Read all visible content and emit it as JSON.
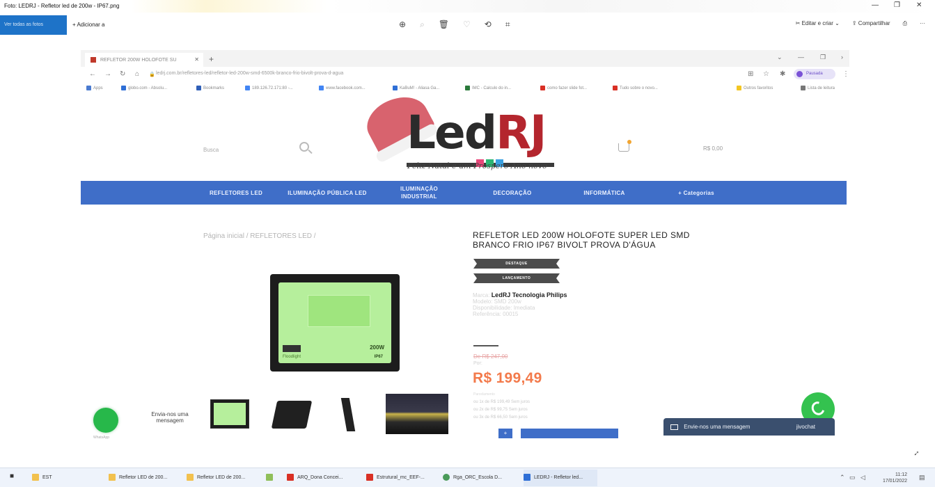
{
  "photos_app": {
    "title": "Foto:  LEDRJ - Refletor led de 200w - IP67.png",
    "see_all_label": "Ver todas as fotos",
    "add_to_label": "Adicionar a",
    "edit_create_label": "Editar e criar",
    "share_label": "Compartilhar",
    "window_controls": [
      "—",
      "❐",
      "✕"
    ]
  },
  "browser": {
    "tab_title": "REFLETOR 200W HOLOFOTE SU",
    "url": "ledrj.com.br/refletores-led/refletor-led-200w-smd-6500k-branco-frio-bivolt-prova-d-agua",
    "profile_label": "Pausada",
    "bookmarks": [
      {
        "label": "Apps",
        "color": "#4a7bd0"
      },
      {
        "label": "globo.com - Absolu...",
        "color": "#2f6fd6"
      },
      {
        "label": "Bookmarks",
        "color": "#2f5fb8"
      },
      {
        "label": "189.126.72.171:80 -...",
        "color": "#4285f4"
      },
      {
        "label": "www.facebook.com...",
        "color": "#4285f4"
      },
      {
        "label": "KaBuM! - Aliasa Ga...",
        "color": "#2f6fd6"
      },
      {
        "label": "IMC - Calculo do in...",
        "color": "#2b7a3b"
      },
      {
        "label": "como fazer slide fot...",
        "color": "#d93025"
      },
      {
        "label": "Tudo sobre o novo...",
        "color": "#d93025"
      },
      {
        "label": "Outros favoritos",
        "color": "#f3c623"
      },
      {
        "label": "Lista de leitura",
        "color": "#777777"
      }
    ]
  },
  "site": {
    "logo_led": "Led",
    "logo_rj": "RJ",
    "tagline": "Feliz Natal e um Prospero Ano novo",
    "search_placeholder": "Busca",
    "cart_total": "R$ 0,00",
    "menu": [
      "REFLETORES LED",
      "ILUMINAÇÃO PÚBLICA LED",
      "ILUMINAÇÃO INDUSTRIAL",
      "DECORAÇÃO",
      "INFORMÁTICA",
      "+ Categorias"
    ],
    "breadcrumb": "Página inicial / REFLETORES LED /",
    "product": {
      "title": "REFLETOR LED 200W HOLOFOTE SUPER LED SMD BRANCO FRIO IP67 BIVOLT PROVA D'ÁGUA",
      "badges": [
        "DESTAQUE",
        "LANÇAMENTO"
      ],
      "brand_label": "Marca:",
      "brand_value": "LedRJ Tecnologia Philips",
      "model": "Modelo: SMD 200w",
      "availability": "Disponibilidade: Imediata",
      "reference": "Referência: 00015",
      "old_price": "De R$ 247,00",
      "por_label": "Por:",
      "price": "R$ 199,49",
      "installments_label": "Parcelamento",
      "installments": [
        "ou 1x de R$ 199,49 Sem juros",
        "ou 2x de R$ 99,75 Sem juros",
        "ou 3x de R$ 66,50 Sem juros"
      ],
      "image_watt": "200W",
      "image_ip": "IP67",
      "image_brand": "Floodlight"
    },
    "whatsapp_message": "Envia-nos uma mensagem",
    "whatsapp_left_label": "WhatsApp",
    "chat_bar_label": "Envie-nos uma mensagem",
    "chat_bar_brand": "jivochat"
  },
  "taskbar": {
    "items": [
      {
        "label": "EST",
        "color": "#f2c14e"
      },
      {
        "label": "Refletor LED de 200...",
        "color": "#f2c14e"
      },
      {
        "label": "Refletor LED de 200...",
        "color": "#f2c14e"
      },
      {
        "label": "",
        "color": "#8fbf5a"
      },
      {
        "label": "ARQ_Dona Concei...",
        "color": "#d93025"
      },
      {
        "label": "Estrutural_mc_EEF-...",
        "color": "#d93025"
      },
      {
        "label": "Rga_ORC_Escola D...",
        "color": "#4a9a5a"
      },
      {
        "label": "LEDRJ - Refletor led...",
        "color": "#2f6fd6"
      }
    ],
    "time": "11:12",
    "date": "17/01/2022"
  }
}
